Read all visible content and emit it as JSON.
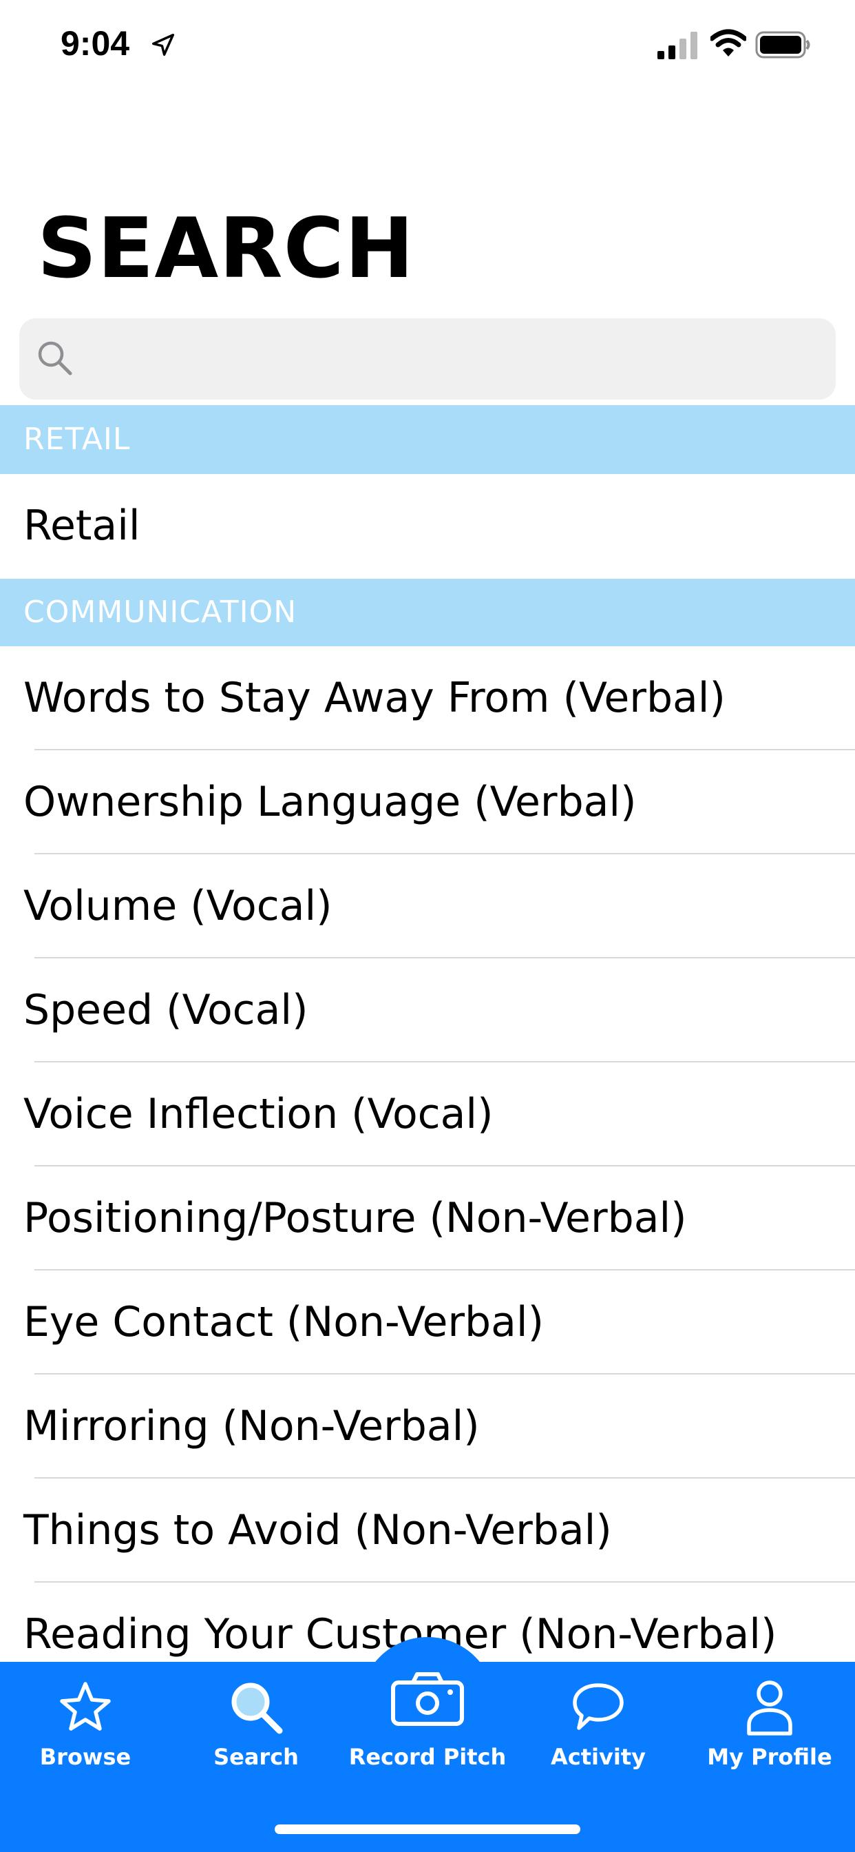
{
  "status_bar": {
    "time": "9:04",
    "icons": [
      "location-arrow-icon",
      "cellular-signal-icon",
      "wifi-icon",
      "battery-icon"
    ]
  },
  "page": {
    "title": "SEARCH"
  },
  "search": {
    "placeholder": "",
    "value": ""
  },
  "sections": [
    {
      "header": "RETAIL",
      "items": [
        "Retail"
      ]
    },
    {
      "header": "COMMUNICATION",
      "items": [
        "Words to Stay Away From (Verbal)",
        "Ownership Language (Verbal)",
        "Volume (Vocal)",
        "Speed (Vocal)",
        "Voice Inflection (Vocal)",
        "Positioning/Posture (Non-Verbal)",
        "Eye Contact (Non-Verbal)",
        "Mirroring (Non-Verbal)",
        "Things to Avoid (Non-Verbal)",
        "Reading Your Customer (Non-Verbal)"
      ]
    }
  ],
  "tab_bar": {
    "tabs": [
      {
        "label": "Browse",
        "icon": "star-icon"
      },
      {
        "label": "Search",
        "icon": "magnifier-icon"
      },
      {
        "label": "Record Pitch",
        "icon": "camera-icon"
      },
      {
        "label": "Activity",
        "icon": "speech-bubble-icon"
      },
      {
        "label": "My Profile",
        "icon": "person-icon"
      }
    ],
    "selected": "Search"
  },
  "colors": {
    "section_header_bg": "#a8dcf9",
    "tab_bar_bg": "#0a7cff",
    "search_bg": "#f0f0f0",
    "selected_tab_icon": "#a8dcf9"
  }
}
